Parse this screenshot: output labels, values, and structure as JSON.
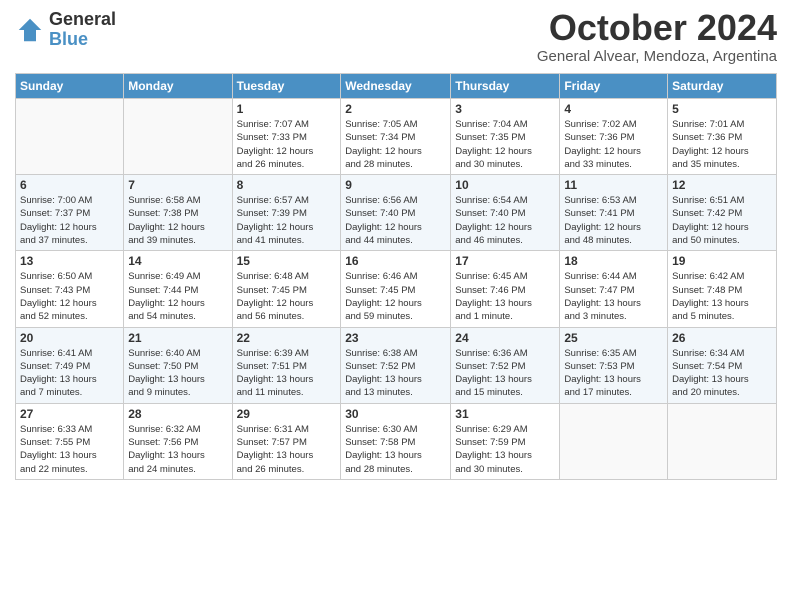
{
  "logo": {
    "general": "General",
    "blue": "Blue"
  },
  "title": "October 2024",
  "location": "General Alvear, Mendoza, Argentina",
  "days_of_week": [
    "Sunday",
    "Monday",
    "Tuesday",
    "Wednesday",
    "Thursday",
    "Friday",
    "Saturday"
  ],
  "weeks": [
    [
      {
        "day": "",
        "info": ""
      },
      {
        "day": "",
        "info": ""
      },
      {
        "day": "1",
        "info": "Sunrise: 7:07 AM\nSunset: 7:33 PM\nDaylight: 12 hours\nand 26 minutes."
      },
      {
        "day": "2",
        "info": "Sunrise: 7:05 AM\nSunset: 7:34 PM\nDaylight: 12 hours\nand 28 minutes."
      },
      {
        "day": "3",
        "info": "Sunrise: 7:04 AM\nSunset: 7:35 PM\nDaylight: 12 hours\nand 30 minutes."
      },
      {
        "day": "4",
        "info": "Sunrise: 7:02 AM\nSunset: 7:36 PM\nDaylight: 12 hours\nand 33 minutes."
      },
      {
        "day": "5",
        "info": "Sunrise: 7:01 AM\nSunset: 7:36 PM\nDaylight: 12 hours\nand 35 minutes."
      }
    ],
    [
      {
        "day": "6",
        "info": "Sunrise: 7:00 AM\nSunset: 7:37 PM\nDaylight: 12 hours\nand 37 minutes."
      },
      {
        "day": "7",
        "info": "Sunrise: 6:58 AM\nSunset: 7:38 PM\nDaylight: 12 hours\nand 39 minutes."
      },
      {
        "day": "8",
        "info": "Sunrise: 6:57 AM\nSunset: 7:39 PM\nDaylight: 12 hours\nand 41 minutes."
      },
      {
        "day": "9",
        "info": "Sunrise: 6:56 AM\nSunset: 7:40 PM\nDaylight: 12 hours\nand 44 minutes."
      },
      {
        "day": "10",
        "info": "Sunrise: 6:54 AM\nSunset: 7:40 PM\nDaylight: 12 hours\nand 46 minutes."
      },
      {
        "day": "11",
        "info": "Sunrise: 6:53 AM\nSunset: 7:41 PM\nDaylight: 12 hours\nand 48 minutes."
      },
      {
        "day": "12",
        "info": "Sunrise: 6:51 AM\nSunset: 7:42 PM\nDaylight: 12 hours\nand 50 minutes."
      }
    ],
    [
      {
        "day": "13",
        "info": "Sunrise: 6:50 AM\nSunset: 7:43 PM\nDaylight: 12 hours\nand 52 minutes."
      },
      {
        "day": "14",
        "info": "Sunrise: 6:49 AM\nSunset: 7:44 PM\nDaylight: 12 hours\nand 54 minutes."
      },
      {
        "day": "15",
        "info": "Sunrise: 6:48 AM\nSunset: 7:45 PM\nDaylight: 12 hours\nand 56 minutes."
      },
      {
        "day": "16",
        "info": "Sunrise: 6:46 AM\nSunset: 7:45 PM\nDaylight: 12 hours\nand 59 minutes."
      },
      {
        "day": "17",
        "info": "Sunrise: 6:45 AM\nSunset: 7:46 PM\nDaylight: 13 hours\nand 1 minute."
      },
      {
        "day": "18",
        "info": "Sunrise: 6:44 AM\nSunset: 7:47 PM\nDaylight: 13 hours\nand 3 minutes."
      },
      {
        "day": "19",
        "info": "Sunrise: 6:42 AM\nSunset: 7:48 PM\nDaylight: 13 hours\nand 5 minutes."
      }
    ],
    [
      {
        "day": "20",
        "info": "Sunrise: 6:41 AM\nSunset: 7:49 PM\nDaylight: 13 hours\nand 7 minutes."
      },
      {
        "day": "21",
        "info": "Sunrise: 6:40 AM\nSunset: 7:50 PM\nDaylight: 13 hours\nand 9 minutes."
      },
      {
        "day": "22",
        "info": "Sunrise: 6:39 AM\nSunset: 7:51 PM\nDaylight: 13 hours\nand 11 minutes."
      },
      {
        "day": "23",
        "info": "Sunrise: 6:38 AM\nSunset: 7:52 PM\nDaylight: 13 hours\nand 13 minutes."
      },
      {
        "day": "24",
        "info": "Sunrise: 6:36 AM\nSunset: 7:52 PM\nDaylight: 13 hours\nand 15 minutes."
      },
      {
        "day": "25",
        "info": "Sunrise: 6:35 AM\nSunset: 7:53 PM\nDaylight: 13 hours\nand 17 minutes."
      },
      {
        "day": "26",
        "info": "Sunrise: 6:34 AM\nSunset: 7:54 PM\nDaylight: 13 hours\nand 20 minutes."
      }
    ],
    [
      {
        "day": "27",
        "info": "Sunrise: 6:33 AM\nSunset: 7:55 PM\nDaylight: 13 hours\nand 22 minutes."
      },
      {
        "day": "28",
        "info": "Sunrise: 6:32 AM\nSunset: 7:56 PM\nDaylight: 13 hours\nand 24 minutes."
      },
      {
        "day": "29",
        "info": "Sunrise: 6:31 AM\nSunset: 7:57 PM\nDaylight: 13 hours\nand 26 minutes."
      },
      {
        "day": "30",
        "info": "Sunrise: 6:30 AM\nSunset: 7:58 PM\nDaylight: 13 hours\nand 28 minutes."
      },
      {
        "day": "31",
        "info": "Sunrise: 6:29 AM\nSunset: 7:59 PM\nDaylight: 13 hours\nand 30 minutes."
      },
      {
        "day": "",
        "info": ""
      },
      {
        "day": "",
        "info": ""
      }
    ]
  ]
}
